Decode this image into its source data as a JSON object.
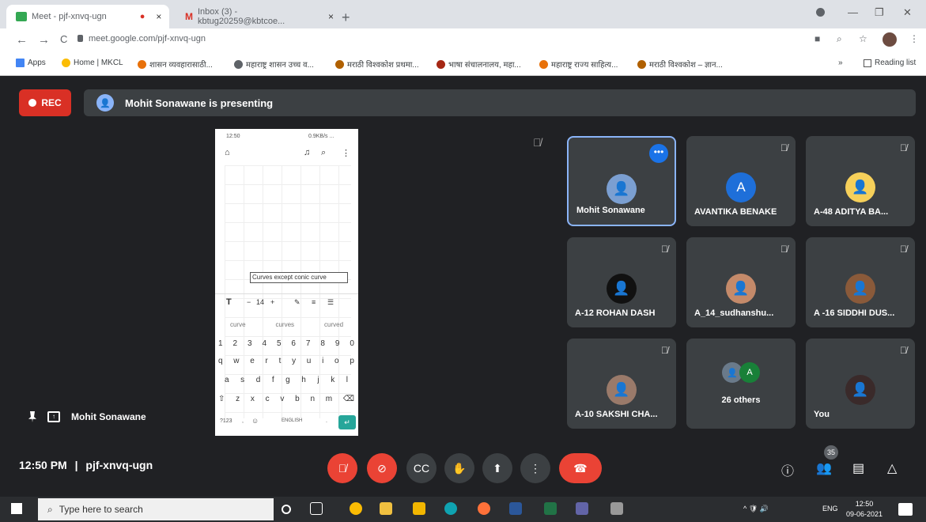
{
  "browser": {
    "tabs": [
      {
        "title": "Meet - pjf-xnvq-ugn",
        "rec": "●",
        "close": "×"
      },
      {
        "title": "Inbox (3) - kbtug20259@kbtcoe...",
        "close": "×"
      }
    ],
    "new_tab": "+",
    "window_controls": {
      "minimize": "—",
      "restore": "❐",
      "close": "✕"
    },
    "nav": {
      "back": "←",
      "forward": "→",
      "reload": "C"
    },
    "url": "meet.google.com/pjf-xnvq-ugn",
    "bookmarks": [
      "Apps",
      "Home | MKCL",
      "शासन व्यवहारासाठी...",
      "महाराष्ट्र शासन उच्च व...",
      "मराठी विश्वकोश प्रथमा...",
      "भाषा संचालनालय, महा...",
      "महाराष्ट्र राज्य साहित्य...",
      "मराठी विश्वकोश – ज्ञान..."
    ],
    "more_bookmarks": "»",
    "reading_list": "Reading list",
    "colors": {
      "chrome_bg": "#dee1e6"
    }
  },
  "meet": {
    "rec_label": "REC",
    "presenting_text": "Mohit Sonawane is presenting",
    "presenter_label": "Mohit Sonawane",
    "time": "12:50 PM",
    "separator": "|",
    "meeting_code": "pjf-xnvq-ugn",
    "participant_count": "35",
    "tiles": [
      {
        "name": "Mohit Sonawane",
        "avatar": "photo",
        "selected": true
      },
      {
        "name": "AVANTIKA BENAKE",
        "avatar_letter": "A"
      },
      {
        "name": "A-48 ADITYA BA...",
        "avatar": "photo"
      },
      {
        "name": "A-12 ROHAN DASH",
        "avatar": "photo"
      },
      {
        "name": "A_14_sudhanshu...",
        "avatar": "photo"
      },
      {
        "name": "A -16 SIDDHI DUS...",
        "avatar": "photo"
      },
      {
        "name": "A-10 SAKSHI CHA...",
        "avatar": "photo"
      },
      {
        "name": "26 others",
        "avatar_letter": "A"
      },
      {
        "name": "You",
        "avatar": "photo"
      }
    ],
    "more_options": "•••",
    "muted_icon": "mic-off-icon",
    "colors": {
      "background": "#202124",
      "tile": "#3c4043",
      "rec": "#d93025",
      "end_call": "#ea4335",
      "muted": "#ea4335",
      "accent": "#8ab4f8"
    }
  },
  "shared_screen": {
    "status_time": "12:50",
    "status_right": "0.9KB/s ... ",
    "toolbar_icons": [
      "home-icon",
      "bell-icon",
      "search-icon",
      "more-icon"
    ],
    "text_box": "Curves except conic curve",
    "format_bar": {
      "t": "T",
      "size": "14",
      "minus": "−",
      "plus": "+"
    },
    "suggestions": [
      "curve",
      "curves",
      "curved"
    ],
    "keyboard_rows": [
      [
        "1",
        "2",
        "3",
        "4",
        "5",
        "6",
        "7",
        "8",
        "9",
        "0"
      ],
      [
        "q",
        "w",
        "e",
        "r",
        "t",
        "y",
        "u",
        "i",
        "o",
        "p"
      ],
      [
        "a",
        "s",
        "d",
        "f",
        "g",
        "h",
        "j",
        "k",
        "l"
      ],
      [
        "⇧",
        "z",
        "x",
        "c",
        "v",
        "b",
        "n",
        "m",
        "⌫"
      ]
    ],
    "bottom_keys": {
      "sym": "?123",
      "comma": ",",
      "emoji": "☺",
      "space": "ENGLISH",
      "dot": ".",
      "enter": "↵"
    }
  },
  "taskbar": {
    "search_placeholder": "Type here to search",
    "tray_lang": "ENG",
    "clock_time": "12:50",
    "clock_date": "09-06-2021",
    "tray_icons": "^ 🛡 🔊"
  }
}
